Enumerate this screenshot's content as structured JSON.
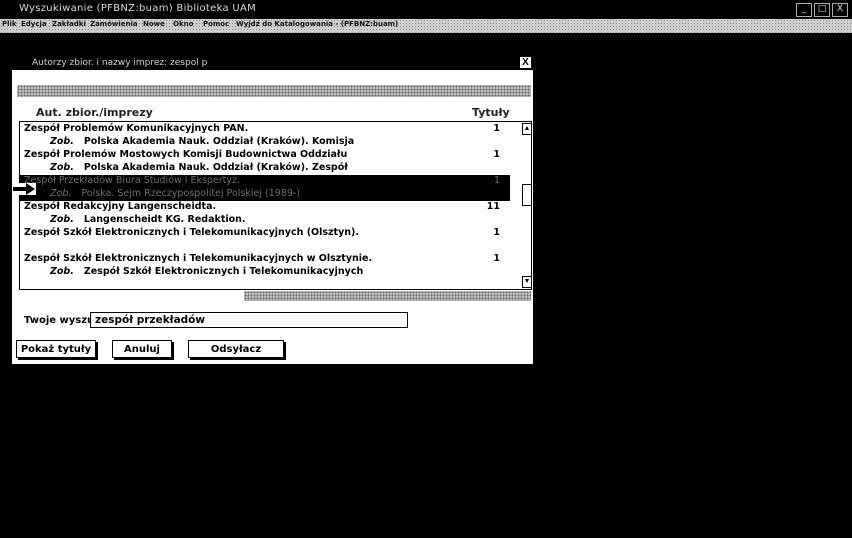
{
  "window": {
    "title": "Wyszukiwanie   (PFBNZ:buam)   Biblioteka UAM",
    "controls": [
      "_",
      "□",
      "X"
    ]
  },
  "menu": [
    "Plik",
    "Edycja",
    "Zakładki",
    "Zamówienia",
    "Nowe",
    "Okno",
    "Pomoc",
    "Wyjdź do Katalogowania - (PFBNZ:buam)"
  ],
  "dialog": {
    "title": "Autorzy zbior. i nazwy imprez: zespol p",
    "close": "X",
    "col_author": "Aut. zbior./imprezy",
    "col_titles": "Tytuły",
    "rows": [
      {
        "text": "Zespół Problemów Komunikacyjnych PAN.",
        "count": "1",
        "selected": false,
        "see": false
      },
      {
        "zob": "Zob.",
        "text": "Polska Akademia Nauk. Oddział (Kraków). Komisja",
        "count": "",
        "selected": false,
        "see": true
      },
      {
        "text": "Zespół Prolemów Mostowych Komisji Budownictwa Oddziału",
        "count": "1",
        "selected": false,
        "see": false
      },
      {
        "zob": "Zob.",
        "text": "Polska Akademia Nauk. Oddział (Kraków). Zespół",
        "count": "",
        "selected": false,
        "see": true
      },
      {
        "text": "Zespół Przekładów Biura Studiów i Ekspertyz.",
        "count": "1",
        "selected": true,
        "see": false
      },
      {
        "zob": "Zob.",
        "text": "Polska. Sejm Rzeczypospolitej Polskiej (1989-)",
        "count": "",
        "selected": true,
        "see": true
      },
      {
        "text": "Zespół Redakcyjny Langenscheidta.",
        "count": "11",
        "selected": false,
        "see": false
      },
      {
        "zob": "Zob.",
        "text": "Langenscheidt KG. Redaktion.",
        "count": "",
        "selected": false,
        "see": true
      },
      {
        "text": "Zespół Szkół Elektronicznych i Telekomunikacyjnych (Olsztyn).",
        "count": "1",
        "selected": false,
        "see": false
      },
      {
        "text": "",
        "count": "",
        "selected": false,
        "see": false
      },
      {
        "text": "Zespół Szkół Elektronicznych i Telekomunikacyjnych w Olsztynie.",
        "count": "1",
        "selected": false,
        "see": false
      },
      {
        "zob": "Zob.",
        "text": "Zespół Szkół Elektronicznych i Telekomunikacyjnych",
        "count": "",
        "selected": false,
        "see": true
      }
    ],
    "search_label": "Twoje wyszuk.:",
    "search_value": "zespół przekładów",
    "btn_show": "Pokaż tytuły",
    "btn_cancel": "Anuluj",
    "btn_ref": "Odsyłacz"
  }
}
